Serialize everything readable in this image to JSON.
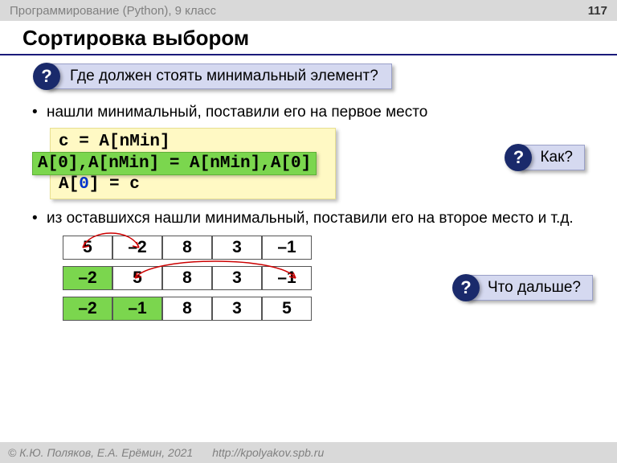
{
  "header": {
    "course": "Программирование (Python), 9 класс",
    "page": "117"
  },
  "title": "Сортировка выбором",
  "q1": {
    "mark": "?",
    "text": "Где должен стоять минимальный элемент?"
  },
  "bullet1": "нашли минимальный, поставили его на первое место",
  "code": {
    "line1": "c = A[nMin]",
    "line2_pre": "A[nMin] = A[",
    "line2_idx": "0",
    "line2_post": "]",
    "line3_pre": "A[",
    "line3_idx": "0",
    "line3_post": "] = c",
    "green": "A[0],A[nMin] = A[nMin],A[0]"
  },
  "q_how": {
    "mark": "?",
    "text": "Как?"
  },
  "bullet2": "из оставшихся нашли минимальный, поставили его на второе место и т.д.",
  "q_next": {
    "mark": "?",
    "text": "Что дальше?"
  },
  "arrays": {
    "row1": [
      {
        "v": "5",
        "fixed": false
      },
      {
        "v": "–2",
        "fixed": false
      },
      {
        "v": "8",
        "fixed": false
      },
      {
        "v": "3",
        "fixed": false
      },
      {
        "v": "–1",
        "fixed": false
      }
    ],
    "row2": [
      {
        "v": "–2",
        "fixed": true
      },
      {
        "v": "5",
        "fixed": false
      },
      {
        "v": "8",
        "fixed": false
      },
      {
        "v": "3",
        "fixed": false
      },
      {
        "v": "–1",
        "fixed": false
      }
    ],
    "row3": [
      {
        "v": "–2",
        "fixed": true
      },
      {
        "v": "–1",
        "fixed": true
      },
      {
        "v": "8",
        "fixed": false
      },
      {
        "v": "3",
        "fixed": false
      },
      {
        "v": "5",
        "fixed": false
      }
    ]
  },
  "footer": {
    "copyright": "© К.Ю. Поляков, Е.А. Ерёмин, 2021",
    "url": "http://kpolyakov.spb.ru"
  }
}
